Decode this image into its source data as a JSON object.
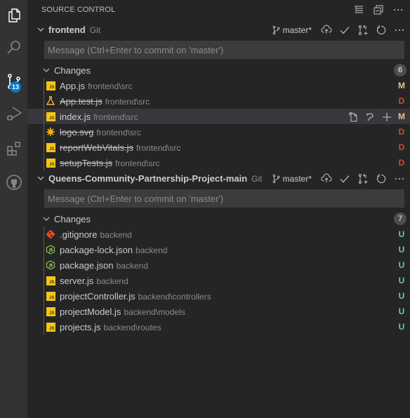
{
  "activity_bar": {
    "items": [
      {
        "name": "explorer",
        "icon": "files-icon"
      },
      {
        "name": "search",
        "icon": "search-icon"
      },
      {
        "name": "source-control",
        "icon": "source-control-icon",
        "badge": "13"
      },
      {
        "name": "run-debug",
        "icon": "debug-icon"
      },
      {
        "name": "extensions",
        "icon": "extensions-icon"
      },
      {
        "name": "github",
        "icon": "github-icon"
      }
    ]
  },
  "header": {
    "title": "SOURCE CONTROL",
    "actions": [
      "view-as-tree-icon",
      "collapse-all-icon",
      "more-actions-icon"
    ]
  },
  "repos": [
    {
      "name": "frontend",
      "provider": "Git",
      "branch": "master*",
      "message_placeholder": "Message (Ctrl+Enter to commit on 'master')",
      "changes_label": "Changes",
      "changes_count": "6",
      "files": [
        {
          "name": "App.js",
          "path": "frontend\\src",
          "status": "M",
          "icon": "js",
          "deleted": false
        },
        {
          "name": "App.test.js",
          "path": "frontend\\src",
          "status": "D",
          "icon": "test",
          "deleted": true
        },
        {
          "name": "index.js",
          "path": "frontend\\src",
          "status": "M",
          "icon": "js",
          "deleted": false,
          "selected": true
        },
        {
          "name": "logo.svg",
          "path": "frontend\\src",
          "status": "D",
          "icon": "svg",
          "deleted": true
        },
        {
          "name": "reportWebVitals.js",
          "path": "frontend\\src",
          "status": "D",
          "icon": "js",
          "deleted": true
        },
        {
          "name": "setupTests.js",
          "path": "frontend\\src",
          "status": "D",
          "icon": "js",
          "deleted": true
        }
      ]
    },
    {
      "name": "Queens-Community-Partnership-Project-main",
      "provider": "Git",
      "branch": "master*",
      "message_placeholder": "Message (Ctrl+Enter to commit on 'master')",
      "changes_label": "Changes",
      "changes_count": "7",
      "files": [
        {
          "name": ".gitignore",
          "path": "backend",
          "status": "U",
          "icon": "git",
          "deleted": false
        },
        {
          "name": "package-lock.json",
          "path": "backend",
          "status": "U",
          "icon": "node",
          "deleted": false
        },
        {
          "name": "package.json",
          "path": "backend",
          "status": "U",
          "icon": "node",
          "deleted": false
        },
        {
          "name": "server.js",
          "path": "backend",
          "status": "U",
          "icon": "js",
          "deleted": false
        },
        {
          "name": "projectController.js",
          "path": "backend\\controllers",
          "status": "U",
          "icon": "js",
          "deleted": false
        },
        {
          "name": "projectModel.js",
          "path": "backend\\models",
          "status": "U",
          "icon": "js",
          "deleted": false
        },
        {
          "name": "projects.js",
          "path": "backend\\routes",
          "status": "U",
          "icon": "js",
          "deleted": false
        }
      ]
    }
  ],
  "status_colors": {
    "M": "#e2c08d",
    "D": "#c74e39",
    "U": "#73c991"
  },
  "colors": {
    "accent": "#007acc",
    "sidebar_bg": "#252526",
    "activity_bg": "#333333",
    "input_bg": "#3c3c3c",
    "selection_bg": "#37373d"
  }
}
